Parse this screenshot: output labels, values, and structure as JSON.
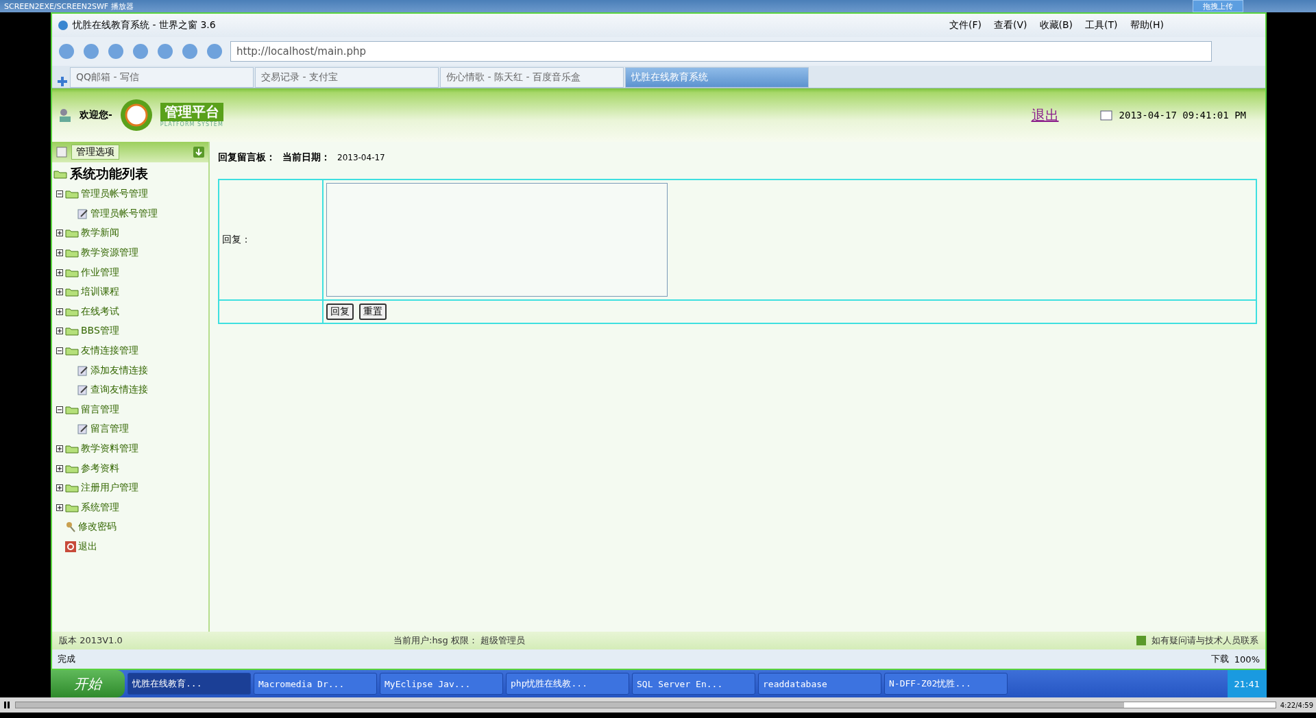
{
  "player": {
    "title": "SCREEN2EXE/SCREEN2SWF 播放器",
    "upload_button": "拖拽上传",
    "time": "4:22/4:59",
    "progress": {
      "level": 0.88
    }
  },
  "window": {
    "title": "忧胜在线教育系统 - 世界之窗 3.6"
  },
  "menu": [
    "文件(F)",
    "查看(V)",
    "收藏(B)",
    "工具(T)",
    "帮助(H)"
  ],
  "address": {
    "value": "http://localhost/main.php"
  },
  "tabs": [
    {
      "label": "QQ邮箱 - 写信",
      "selected": false
    },
    {
      "label": "交易记录 - 支付宝",
      "selected": false
    },
    {
      "label": "伤心情歌 - 陈天红 - 百度音乐盒",
      "selected": false
    },
    {
      "label": "忧胜在线教育系统",
      "selected": true
    }
  ],
  "header": {
    "welcome": "欢迎您-",
    "logo_title": "管理平台",
    "logo_subtitle": "PLATFORM SYSTEM",
    "logout": "退出",
    "datetime": "2013-04-17 09:41:01 PM"
  },
  "sidebar": {
    "title": "管理选项",
    "tree_title": "系统功能列表",
    "items": [
      {
        "label": "管理员帐号管理",
        "kind": "folder",
        "expanded": true,
        "children": [
          {
            "label": "管理员帐号管理",
            "kind": "page"
          }
        ]
      },
      {
        "label": "教学新闻",
        "kind": "folder",
        "expanded": false
      },
      {
        "label": "教学资源管理",
        "kind": "folder",
        "expanded": false
      },
      {
        "label": "作业管理",
        "kind": "folder",
        "expanded": false
      },
      {
        "label": "培训课程",
        "kind": "folder",
        "expanded": false
      },
      {
        "label": "在线考试",
        "kind": "folder",
        "expanded": false
      },
      {
        "label": "BBS管理",
        "kind": "folder",
        "expanded": false
      },
      {
        "label": "友情连接管理",
        "kind": "folder",
        "expanded": true,
        "children": [
          {
            "label": "添加友情连接",
            "kind": "page"
          },
          {
            "label": "查询友情连接",
            "kind": "page"
          }
        ]
      },
      {
        "label": "留言管理",
        "kind": "folder",
        "expanded": true,
        "children": [
          {
            "label": "留言管理",
            "kind": "page"
          }
        ]
      },
      {
        "label": "教学资料管理",
        "kind": "folder",
        "expanded": false
      },
      {
        "label": "参考资料",
        "kind": "folder",
        "expanded": false
      },
      {
        "label": "注册用户管理",
        "kind": "folder",
        "expanded": false
      },
      {
        "label": "系统管理",
        "kind": "folder",
        "expanded": false
      },
      {
        "label": "修改密码",
        "kind": "key"
      },
      {
        "label": "退出",
        "kind": "exit"
      }
    ]
  },
  "content": {
    "heading": "回复留言板：",
    "date_label": "当前日期：",
    "date": "2013-04-17",
    "reply_label": "回复：",
    "buttons": [
      "回复",
      "重置"
    ]
  },
  "footer": {
    "version": "版本 2013V1.0",
    "user": "当前用户:hsg 权限： 超级管理员",
    "help": "如有疑问请与技术人员联系"
  },
  "status_bar": {
    "text": "完成",
    "download": "下载",
    "zoom": "100%"
  },
  "taskbar": {
    "start": "开始",
    "tasks": [
      {
        "label": "忧胜在线教育...",
        "selected": true
      },
      {
        "label": "Macromedia Dr...",
        "selected": false
      },
      {
        "label": "MyEclipse Jav...",
        "selected": false
      },
      {
        "label": "php忧胜在线教...",
        "selected": false
      },
      {
        "label": "SQL Server En...",
        "selected": false
      },
      {
        "label": "readdatabase",
        "selected": false
      },
      {
        "label": "N-DFF-Z02忧胜...",
        "selected": false
      }
    ],
    "clock": "21:41"
  }
}
